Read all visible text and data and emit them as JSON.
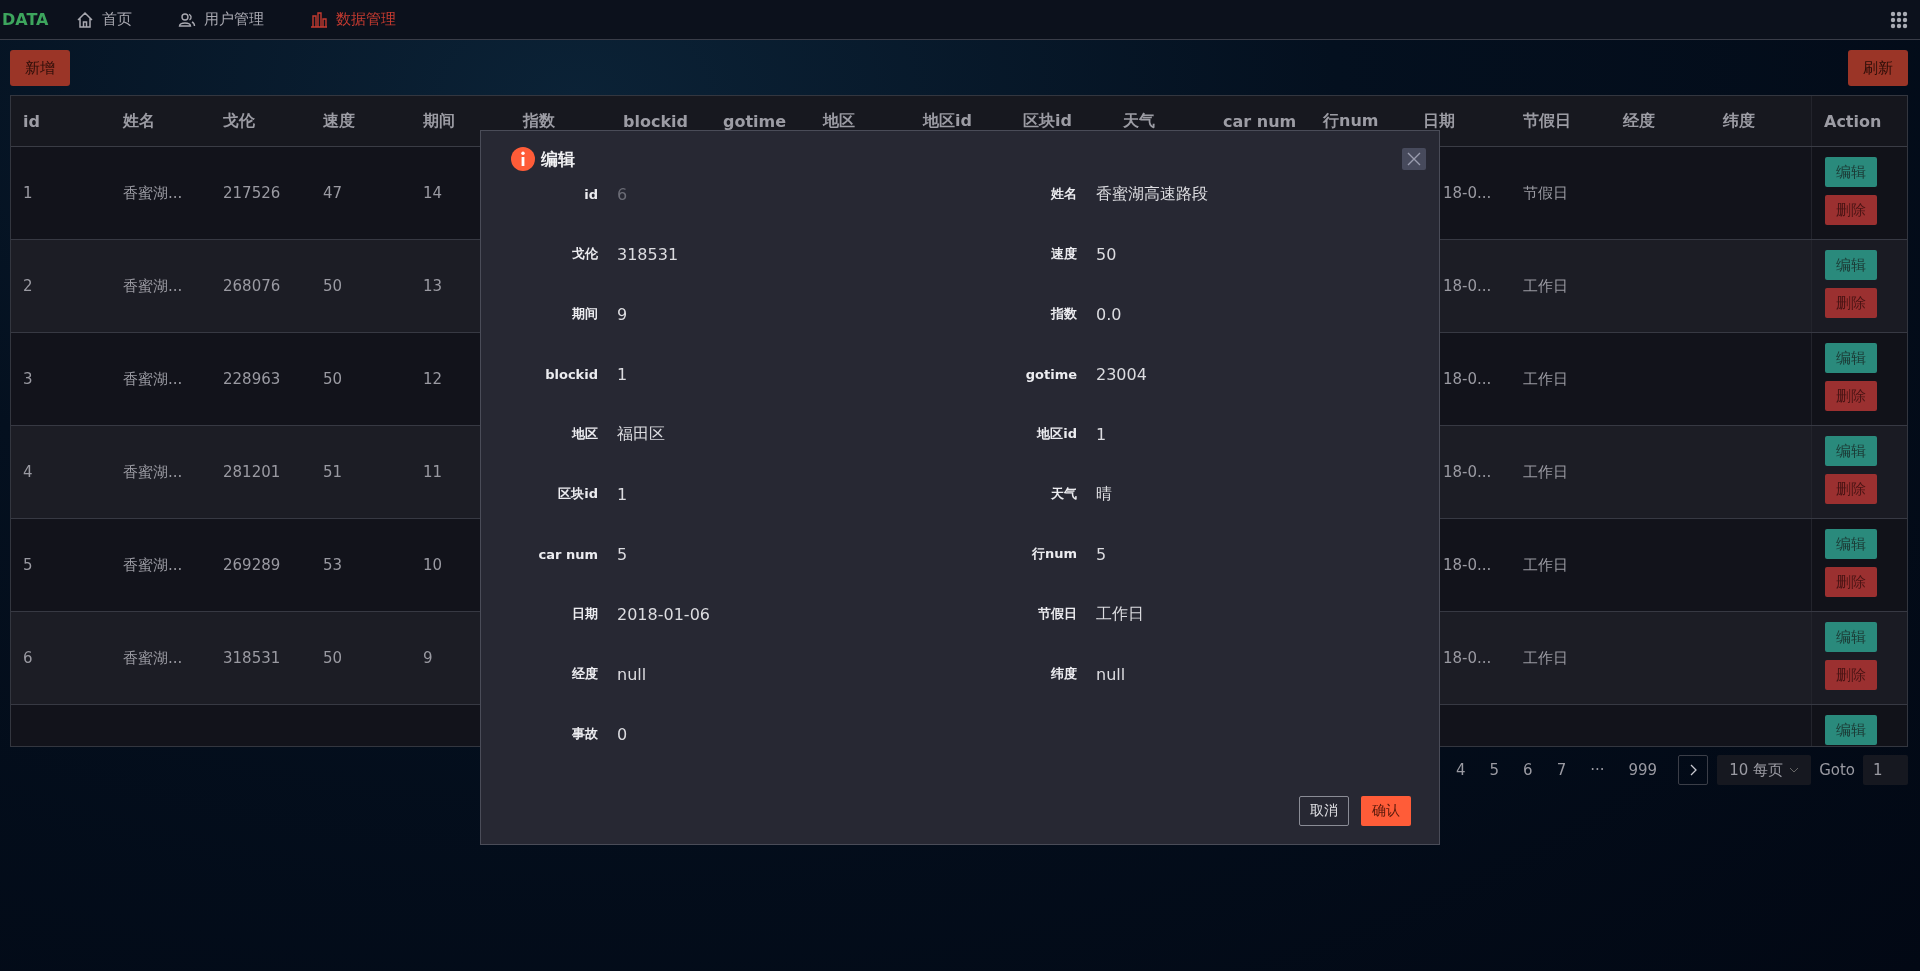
{
  "nav": {
    "brand": "DATA",
    "items": [
      {
        "label": "首页",
        "kind": "home",
        "selected": false
      },
      {
        "label": "用户管理",
        "kind": "users",
        "selected": false
      },
      {
        "label": "数据管理",
        "kind": "data",
        "selected": true
      }
    ]
  },
  "toolbar": {
    "add_button": "新增",
    "refresh_button": "刷新"
  },
  "table": {
    "columns": [
      "id",
      "姓名",
      "戈伦",
      "速度",
      "期间",
      "指数",
      "blockid",
      "gotime",
      "地区",
      "地区id",
      "区块id",
      "天气",
      "car num",
      "行num",
      "日期",
      "节假日",
      "经度",
      "纬度"
    ],
    "action_column": "Action",
    "rows": [
      {
        "id": "1",
        "name": "香蜜湖...",
        "gallon": "217526",
        "speed": "47",
        "period": "14",
        "date": "18-0...",
        "holiday": "节假日",
        "buttons": [
          {
            "label": "编辑",
            "kind": "edit"
          },
          {
            "label": "删除",
            "kind": "delete"
          }
        ]
      },
      {
        "id": "2",
        "name": "香蜜湖...",
        "gallon": "268076",
        "speed": "50",
        "period": "13",
        "date": "18-0...",
        "holiday": "工作日",
        "buttons": [
          {
            "label": "编辑",
            "kind": "edit"
          },
          {
            "label": "删除",
            "kind": "delete"
          }
        ]
      },
      {
        "id": "3",
        "name": "香蜜湖...",
        "gallon": "228963",
        "speed": "50",
        "period": "12",
        "date": "18-0...",
        "holiday": "工作日",
        "buttons": [
          {
            "label": "编辑",
            "kind": "edit"
          },
          {
            "label": "删除",
            "kind": "delete"
          }
        ]
      },
      {
        "id": "4",
        "name": "香蜜湖...",
        "gallon": "281201",
        "speed": "51",
        "period": "11",
        "date": "18-0...",
        "holiday": "工作日",
        "buttons": [
          {
            "label": "编辑",
            "kind": "edit"
          },
          {
            "label": "删除",
            "kind": "delete"
          }
        ]
      },
      {
        "id": "5",
        "name": "香蜜湖...",
        "gallon": "269289",
        "speed": "53",
        "period": "10",
        "date": "18-0...",
        "holiday": "工作日",
        "buttons": [
          {
            "label": "编辑",
            "kind": "edit"
          },
          {
            "label": "删除",
            "kind": "delete"
          }
        ]
      },
      {
        "id": "6",
        "name": "香蜜湖...",
        "gallon": "318531",
        "speed": "50",
        "period": "9",
        "date": "18-0...",
        "holiday": "工作日",
        "buttons": [
          {
            "label": "编辑",
            "kind": "edit"
          },
          {
            "label": "删除",
            "kind": "delete"
          }
        ]
      },
      {
        "buttons": [
          {
            "label": "编辑",
            "kind": "edit"
          }
        ]
      }
    ]
  },
  "pagination": {
    "pages": [
      "4",
      "5",
      "6",
      "7",
      "···",
      "999"
    ],
    "page_size": "10 每页",
    "goto_label": "Goto",
    "goto_value": "1"
  },
  "dialog": {
    "title": "编辑",
    "fields": [
      {
        "label": "id",
        "value": "6",
        "disabled": true
      },
      {
        "label": "姓名",
        "value": "香蜜湖高速路段",
        "disabled": false
      },
      {
        "label": "戈伦",
        "value": "318531",
        "disabled": false
      },
      {
        "label": "速度",
        "value": "50",
        "disabled": false
      },
      {
        "label": "期间",
        "value": "9",
        "disabled": false
      },
      {
        "label": "指数",
        "value": "0.0",
        "disabled": false
      },
      {
        "label": "blockid",
        "value": "1",
        "disabled": false
      },
      {
        "label": "gotime",
        "value": "23004",
        "disabled": false
      },
      {
        "label": "地区",
        "value": "福田区",
        "disabled": false
      },
      {
        "label": "地区id",
        "value": "1",
        "disabled": false
      },
      {
        "label": "区块id",
        "value": "1",
        "disabled": false
      },
      {
        "label": "天气",
        "value": "晴",
        "disabled": false
      },
      {
        "label": "car num",
        "value": "5",
        "disabled": false
      },
      {
        "label": "行num",
        "value": "5",
        "disabled": false
      },
      {
        "label": "日期",
        "value": "2018-01-06",
        "disabled": false
      },
      {
        "label": "节假日",
        "value": "工作日",
        "disabled": false
      },
      {
        "label": "经度",
        "value": "null",
        "disabled": false
      },
      {
        "label": "纬度",
        "value": "null",
        "disabled": false
      },
      {
        "label": "事故",
        "value": "0",
        "disabled": false
      }
    ],
    "cancel": "取消",
    "confirm": "确认"
  }
}
